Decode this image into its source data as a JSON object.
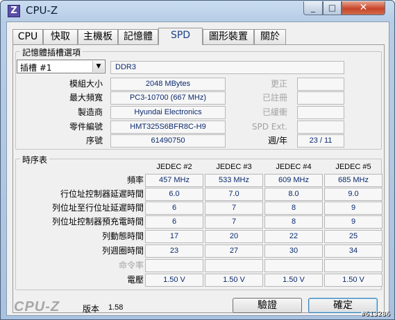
{
  "window": {
    "title": "CPU-Z",
    "icon_letter": "Z",
    "min": "_",
    "max": "□",
    "close": "✕"
  },
  "tabs": [
    "CPU",
    "快取",
    "主機板",
    "記憶體",
    "SPD",
    "圖形裝置",
    "關於"
  ],
  "slot_group": {
    "title": "記憶體插槽選項",
    "slot_select": "插槽 #1",
    "memory_type": "DDR3",
    "rows_left": [
      {
        "label": "模組大小",
        "value": "2048 MBytes"
      },
      {
        "label": "最大頻寬",
        "value": "PC3-10700 (667 MHz)"
      },
      {
        "label": "製造商",
        "value": "Hyundai Electronics"
      },
      {
        "label": "零件編號",
        "value": "HMT325S6BFR8C-H9"
      },
      {
        "label": "序號",
        "value": "61490750"
      }
    ],
    "rows_right": [
      {
        "label": "更正",
        "value": ""
      },
      {
        "label": "已註冊",
        "value": ""
      },
      {
        "label": "已緩衝",
        "value": ""
      },
      {
        "label": "SPD Ext.",
        "value": ""
      },
      {
        "label": "週/年",
        "value": "23 / 11"
      }
    ]
  },
  "timing_group": {
    "title": "時序表",
    "columns": [
      "JEDEC #2",
      "JEDEC #3",
      "JEDEC #4",
      "JEDEC #5"
    ],
    "rows": [
      {
        "label": "頻率",
        "values": [
          "457 MHz",
          "533 MHz",
          "609 MHz",
          "685 MHz"
        ]
      },
      {
        "label": "行位址控制器延遲時間",
        "values": [
          "6.0",
          "7.0",
          "8.0",
          "9.0"
        ]
      },
      {
        "label": "列位址至行位址延遲時間",
        "values": [
          "6",
          "7",
          "8",
          "9"
        ]
      },
      {
        "label": "列位址控制器預充電時間",
        "values": [
          "6",
          "7",
          "8",
          "9"
        ]
      },
      {
        "label": "列動態時間",
        "values": [
          "17",
          "20",
          "22",
          "25"
        ]
      },
      {
        "label": "列週圈時間",
        "values": [
          "23",
          "27",
          "30",
          "34"
        ]
      },
      {
        "label": "命令率",
        "values": [
          "",
          "",
          "",
          ""
        ]
      },
      {
        "label": "電壓",
        "values": [
          "1.50 V",
          "1.50 V",
          "1.50 V",
          "1.50 V"
        ]
      }
    ]
  },
  "footer": {
    "logo": "CPU-Z",
    "version_label": "版本",
    "version_value": "1.58",
    "validate_button": "驗證",
    "ok_button": "確定",
    "watermark": "#613286"
  }
}
